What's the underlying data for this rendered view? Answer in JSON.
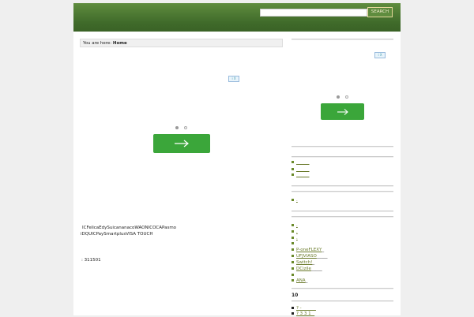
{
  "header": {
    "search_placeholder": "",
    "search_button_label": "SEARCH"
  },
  "breadcrumb": {
    "prefix": "You are here:",
    "current": "Home"
  },
  "main": {
    "adchoice_label": "i X",
    "text_line1": "ICFelicaEdySuicananacoWAONICOCAPasmo",
    "text_line2": "iDQUICPaySmartplusVISA TOUCH",
    "text_line3": ": 311501"
  },
  "sidebar": {
    "adchoice_label": "i X",
    "group1": [
      "______",
      "______",
      "______"
    ],
    "group2": [
      "."
    ],
    "group3": [
      ".",
      ".",
      ".",
      "",
      "P-oneFLEXY",
      "UFJVIASO",
      "Switch!",
      "DCizile",
      "",
      "ANA"
    ],
    "group3_suffixes": [
      "",
      "",
      "",
      "",
      "_",
      "_____",
      "_",
      "_____",
      "",
      "_"
    ],
    "heading": "10",
    "group4": [
      "? - ______",
      "? 3 3 1 _"
    ]
  },
  "colors": {
    "header": "#4a7530",
    "accent_button": "#3ba63a",
    "link": "#6a7a2a"
  }
}
